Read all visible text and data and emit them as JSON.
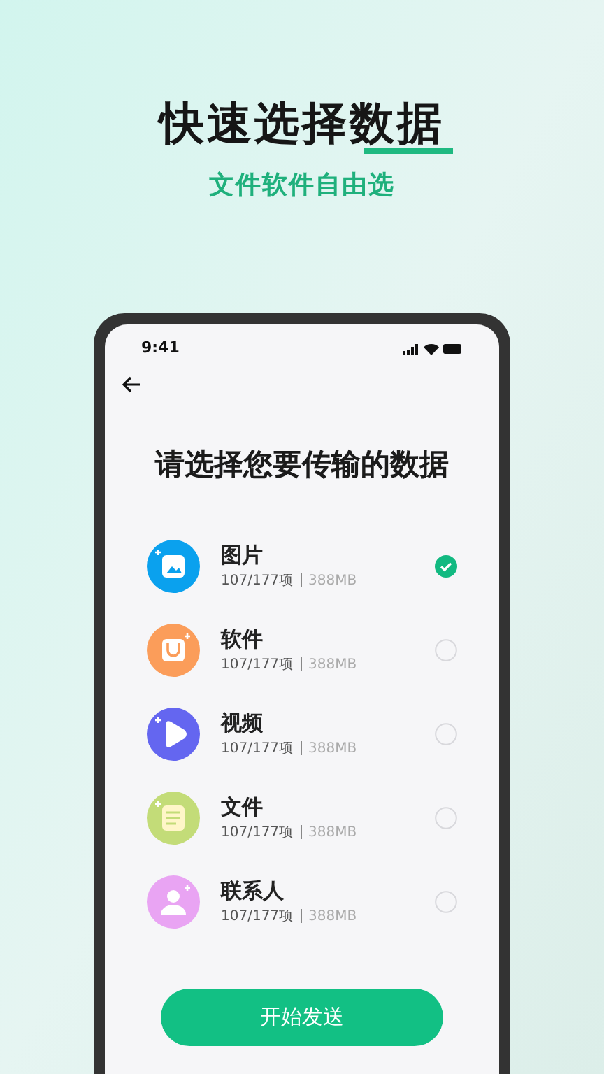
{
  "headline": "快速选择数据",
  "subheadline": "文件软件自由选",
  "phone": {
    "status_bar": {
      "time": "9:41"
    },
    "title": "请选择您要传输的数据",
    "items": [
      {
        "kind": "image",
        "color": "#0aa1ee",
        "name": "图片",
        "count": "107/177项",
        "size": "388MB",
        "selected": true
      },
      {
        "kind": "app",
        "color": "#fb9d5a",
        "name": "软件",
        "count": "107/177项",
        "size": "388MB",
        "selected": false
      },
      {
        "kind": "video",
        "color": "#6466f0",
        "name": "视频",
        "count": "107/177项",
        "size": "388MB",
        "selected": false
      },
      {
        "kind": "file",
        "color": "#c3dc78",
        "name": "文件",
        "count": "107/177项",
        "size": "388MB",
        "selected": false
      },
      {
        "kind": "contact",
        "color": "#e9a4f3",
        "name": "联系人",
        "count": "107/177项",
        "size": "388MB",
        "selected": false
      }
    ],
    "button": "开始发送"
  }
}
